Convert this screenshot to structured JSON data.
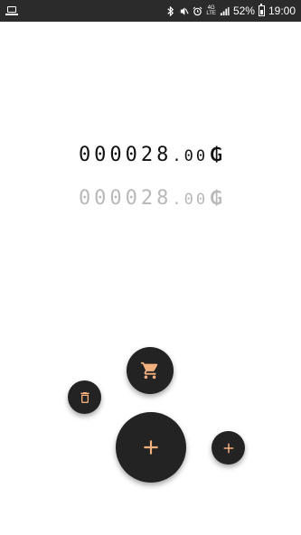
{
  "status_bar": {
    "battery_percent": "52%",
    "time": "19:00",
    "network": "4G",
    "network_sub": "LTE",
    "icons": [
      "laptop-icon",
      "bluetooth-icon",
      "mute-icon",
      "alarm-icon",
      "signal-icon",
      "battery-icon"
    ]
  },
  "balance": {
    "primary": {
      "integer": "000028",
      "decimal": ".00",
      "currency": "₲"
    },
    "secondary": {
      "integer": "000028",
      "decimal": ".00",
      "currency": "₲"
    }
  },
  "actions": {
    "icons": [
      "cart-icon",
      "delete-icon",
      "plus-icon",
      "plus-icon"
    ],
    "accent_color": "#f2b07f",
    "fab_color": "#232323"
  }
}
